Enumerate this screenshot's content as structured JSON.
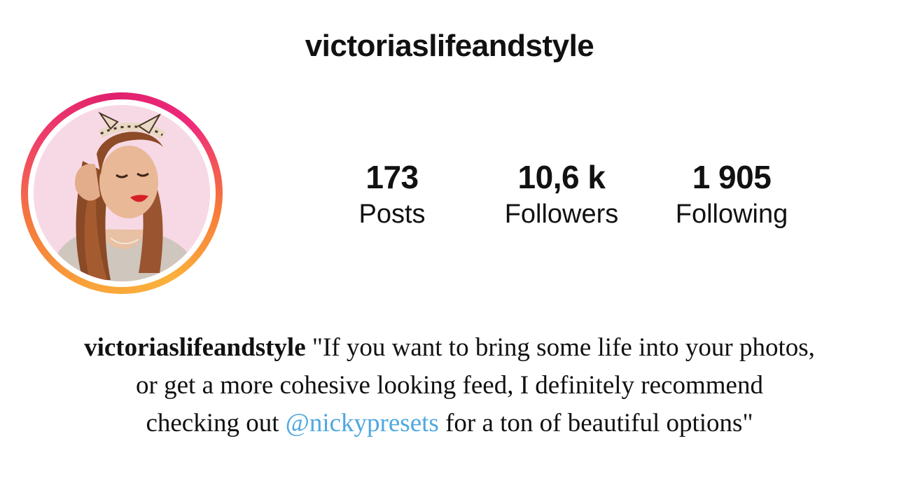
{
  "header": {
    "username": "victoriaslifeandstyle"
  },
  "avatar": {
    "icon": "profile-illustration-icon",
    "ring_colors": [
      "#f9a33b",
      "#ef3e6a",
      "#e0206d"
    ]
  },
  "stats": {
    "posts": {
      "value": "173",
      "label": "Posts"
    },
    "followers": {
      "value": "10,6 k",
      "label": "Followers"
    },
    "following": {
      "value": "1 905",
      "label": "Following"
    }
  },
  "caption": {
    "username": "victoriaslifeandstyle",
    "line1_text": " \"If you want to bring some life into your photos,",
    "line2_text": "or get a more cohesive looking feed, I definitely recommend",
    "line3_before": "checking out ",
    "mention": "@nickypresets",
    "line3_after": " for a ton of beautiful options\"",
    "mention_color": "#4fa8df"
  }
}
